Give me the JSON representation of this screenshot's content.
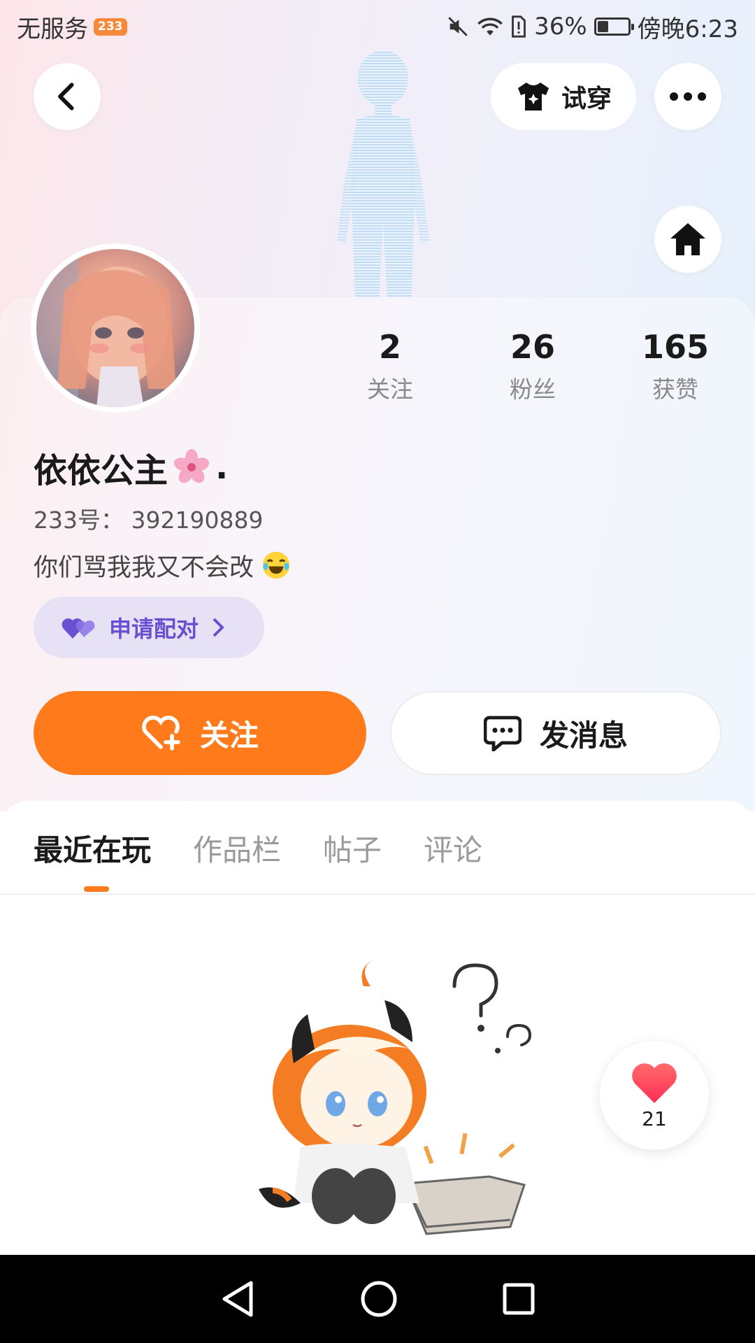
{
  "status_bar": {
    "carrier": "无服务",
    "carrier_badge": "233",
    "battery": "36%",
    "battery_level": 0.36,
    "time": "傍晚6:23"
  },
  "top_bar": {
    "back_icon": "chevron-left-icon",
    "tryon_label": "试穿",
    "more_icon": "more-horizontal-icon",
    "home_icon": "home-icon"
  },
  "profile": {
    "name": "依依公主",
    "name_suffix": ".",
    "uid": "233号： 392190889",
    "bio": "你们骂我我又不会改"
  },
  "stats": [
    {
      "value": "2",
      "label": "关注"
    },
    {
      "value": "26",
      "label": "粉丝"
    },
    {
      "value": "165",
      "label": "获赞"
    }
  ],
  "match": {
    "label": "申请配对"
  },
  "actions": {
    "follow_label": "关注",
    "message_label": "发消息"
  },
  "tabs": [
    {
      "label": "最近在玩",
      "active": true
    },
    {
      "label": "作品栏",
      "active": false
    },
    {
      "label": "帖子",
      "active": false
    },
    {
      "label": "评论",
      "active": false
    }
  ],
  "like": {
    "count": "21"
  },
  "colors": {
    "accent": "#ff7a1a",
    "match_bg": "#e7e1f5",
    "match_text": "#6a4fd0"
  }
}
